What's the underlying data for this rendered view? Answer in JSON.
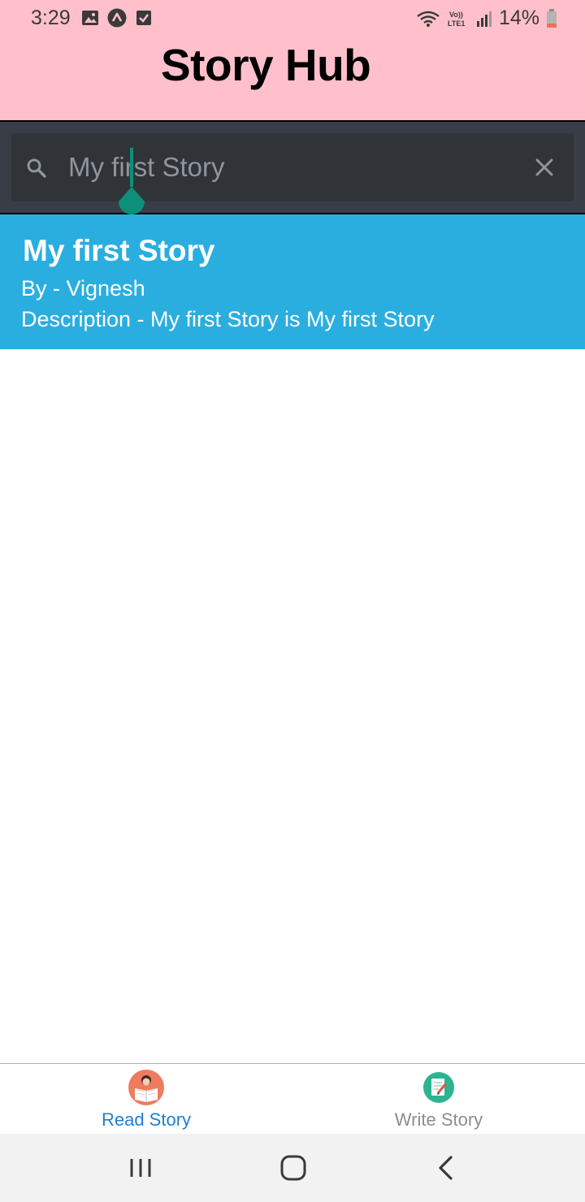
{
  "status_bar": {
    "time": "3:29",
    "battery": "14%",
    "left_icons": [
      "image-icon",
      "app-icon",
      "checkbox-icon"
    ],
    "right_icons": [
      "wifi-icon",
      "volte-icon",
      "signal-icon",
      "battery-icon"
    ],
    "network_label": "Vo)) LTE1"
  },
  "header": {
    "title": "Story Hub",
    "background": "#ffc0cb"
  },
  "search": {
    "value": "My first Story",
    "icon": "search-icon",
    "clear_icon": "close-icon"
  },
  "results": [
    {
      "title": "My first Story",
      "author": "By - Vignesh",
      "description": "Description - My first Story is My first Story"
    }
  ],
  "tabs": [
    {
      "label": "Read Story",
      "icon": "reading-icon",
      "active": true,
      "color": "#1f7fd0"
    },
    {
      "label": "Write Story",
      "icon": "writing-icon",
      "active": false,
      "color": "#8d8d8d"
    }
  ],
  "nav": {
    "buttons": [
      "recents-icon",
      "home-icon",
      "back-icon"
    ]
  },
  "colors": {
    "card": "#2aaee0",
    "search_bg": "#393e46",
    "cursor": "#0d8f7a"
  }
}
